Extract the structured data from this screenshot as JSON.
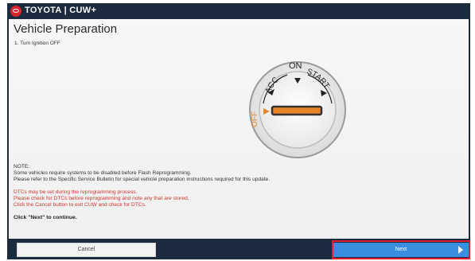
{
  "header": {
    "brand": "TOYOTA | CUW+",
    "logo_icon": "toyota-logo-icon"
  },
  "page": {
    "title": "Vehicle Preparation",
    "step": "1. Turn Ignition OFF"
  },
  "ignition": {
    "labels": {
      "off": "OFF",
      "acc": "ACC",
      "on": "ON",
      "start": "START"
    },
    "current_position": "OFF"
  },
  "notes": {
    "heading": "NOTE:",
    "line1": "Some vehicles require systems to be disabled before Flash Reprogramming.",
    "line2": "Please refer to the Specific Service Bulletin for special vehicle preparation instructions required for this update."
  },
  "warning": {
    "line1": "DTCs may be set during the reprogramming process.",
    "line2": "Please check for DTCs before reprogramming and note any that are stored.",
    "line3": "Click the Cancel button to exit CUW and check for DTCs."
  },
  "instruction": "Click \"Next\" to continue.",
  "footer": {
    "cancel_label": "Cancel",
    "next_label": "Next",
    "next_icon": "chevron-right-icon"
  },
  "colors": {
    "header_bg": "#1c2b3d",
    "brand_red": "#d8242b",
    "warning_red": "#d4362c",
    "next_blue": "#3a8ee0",
    "highlight_red": "#e11d2f",
    "key_orange": "#e8852a"
  }
}
